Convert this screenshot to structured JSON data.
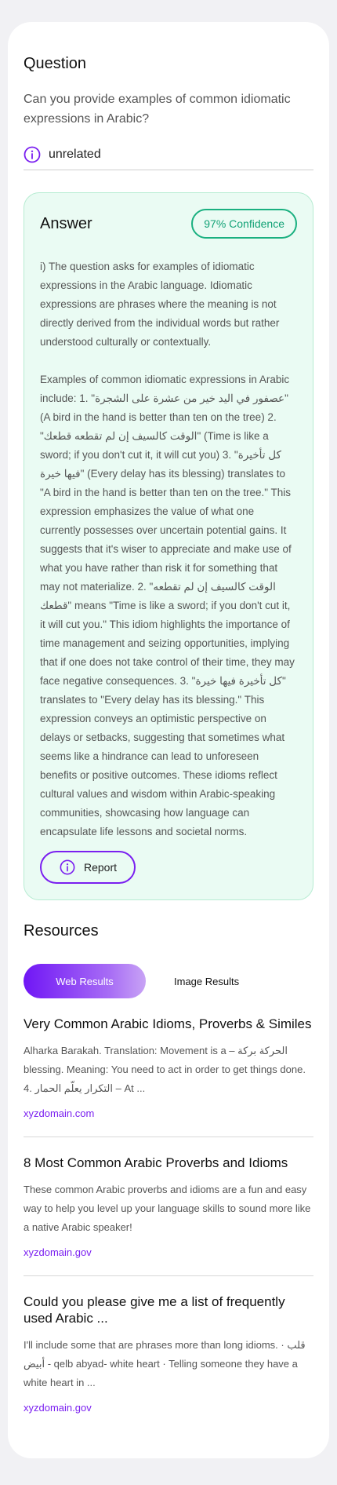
{
  "question": {
    "heading": "Question",
    "text": "Can you provide examples of common idiomatic expressions in Arabic?",
    "category_icon": "info-icon",
    "category": "unrelated"
  },
  "answer": {
    "title": "Answer",
    "confidence": "97% Confidence",
    "paragraph_1": "i) The question asks for examples of idiomatic expressions in the Arabic language. Idiomatic expressions are phrases where the meaning is not directly derived from the individual words but rather understood culturally or contextually.",
    "paragraph_2": "Examples of common idiomatic expressions in Arabic include: 1. \"عصفور في اليد خير من عشرة على الشجرة\" (A bird in the hand is better than ten on the tree) 2. \"الوقت كالسيف إن لم تقطعه قطعك\" (Time is like a sword; if you don't cut it, it will cut you) 3. \"كل تأخيرة فيها خيرة\" (Every delay has its blessing) translates to \"A bird in the hand is better than ten on the tree.\" This expression emphasizes the value of what one currently possesses over uncertain potential gains. It suggests that it's wiser to appreciate and make use of what you have rather than risk it for something that may not materialize. 2. \"الوقت كالسيف إن لم تقطعه قطعك\" means \"Time is like a sword; if you don't cut it, it will cut you.\" This idiom highlights the importance of time management and seizing opportunities, implying that if one does not take control of their time, they may face negative consequences. 3. \"كل تأخيرة فيها خيرة\" translates to \"Every delay has its blessing.\" This expression conveys an optimistic perspective on delays or setbacks, suggesting that sometimes what seems like a hindrance can lead to unforeseen benefits or positive outcomes. These idioms reflect cultural values and wisdom within Arabic-speaking communities, showcasing how language can encapsulate life lessons and societal norms.",
    "report_label": "Report"
  },
  "resources": {
    "heading": "Resources",
    "tabs": [
      {
        "label": "Web Results"
      },
      {
        "label": "Image Results"
      }
    ],
    "results": [
      {
        "title": "Very Common Arabic Idioms, Proverbs & Similes",
        "snippet": "Alharka Barakah. Translation: Movement is a – الحركة بركة blessing. Meaning: You need to act in order to get things done. 4. التكرار يعلّم الحمار – At ...",
        "link": "xyzdomain.com"
      },
      {
        "title": "8 Most Common Arabic Proverbs and Idioms",
        "snippet": "These common Arabic proverbs and idioms are a fun and easy way to help you level up your language skills to sound more like a native Arabic speaker!",
        "link": "xyzdomain.gov"
      },
      {
        "title": "Could you please give me a list of frequently used Arabic ...",
        "snippet": "I'll include some that are phrases more than long idioms. · قلب أبيض - qelb abyad- white heart · Telling someone they have a white heart in ...",
        "link": "xyzdomain.gov"
      }
    ]
  },
  "colors": {
    "accent": "#7a1ff0",
    "confidence": "#12a276",
    "answer_bg": "#eafbf3"
  }
}
